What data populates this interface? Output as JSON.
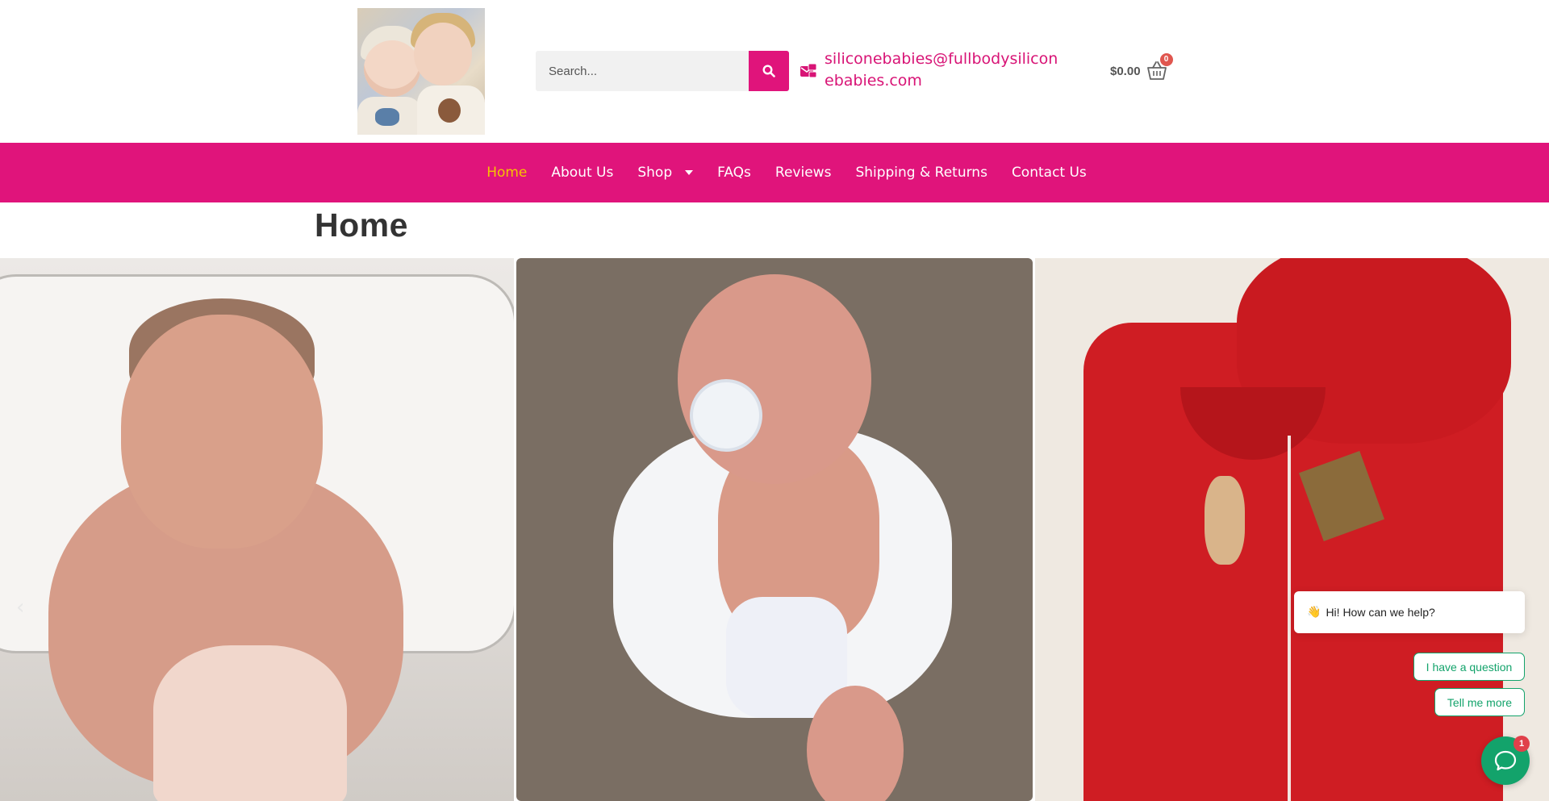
{
  "header": {
    "logo_alt": "Full body silicone babies",
    "search": {
      "placeholder": "Search...",
      "value": ""
    },
    "contact_email": "siliconebabies@fullbodysiliconebabies.com",
    "cart": {
      "total": "$0.00",
      "count": "0"
    }
  },
  "nav": {
    "items": [
      {
        "label": "Home",
        "active": true
      },
      {
        "label": "About Us"
      },
      {
        "label": "Shop",
        "has_dropdown": true
      },
      {
        "label": "FAQs"
      },
      {
        "label": "Reviews"
      },
      {
        "label": "Shipping & Returns"
      },
      {
        "label": "Contact Us"
      }
    ]
  },
  "page": {
    "title": "Home"
  },
  "gallery": {
    "prev_arrow": "‹"
  },
  "chat": {
    "greeting_emoji": "👋",
    "greeting": "Hi! How can we help?",
    "options": [
      "I have a question",
      "Tell me more"
    ],
    "unread_count": "1"
  },
  "colors": {
    "brand": "#e0147b",
    "nav_active": "#f5c400",
    "chat_green": "#13a36b",
    "badge_red": "#e0564f"
  },
  "icons": {
    "search": "search-icon",
    "contact": "envelope-icon",
    "cart": "cart-icon",
    "chat": "chat-icon"
  }
}
